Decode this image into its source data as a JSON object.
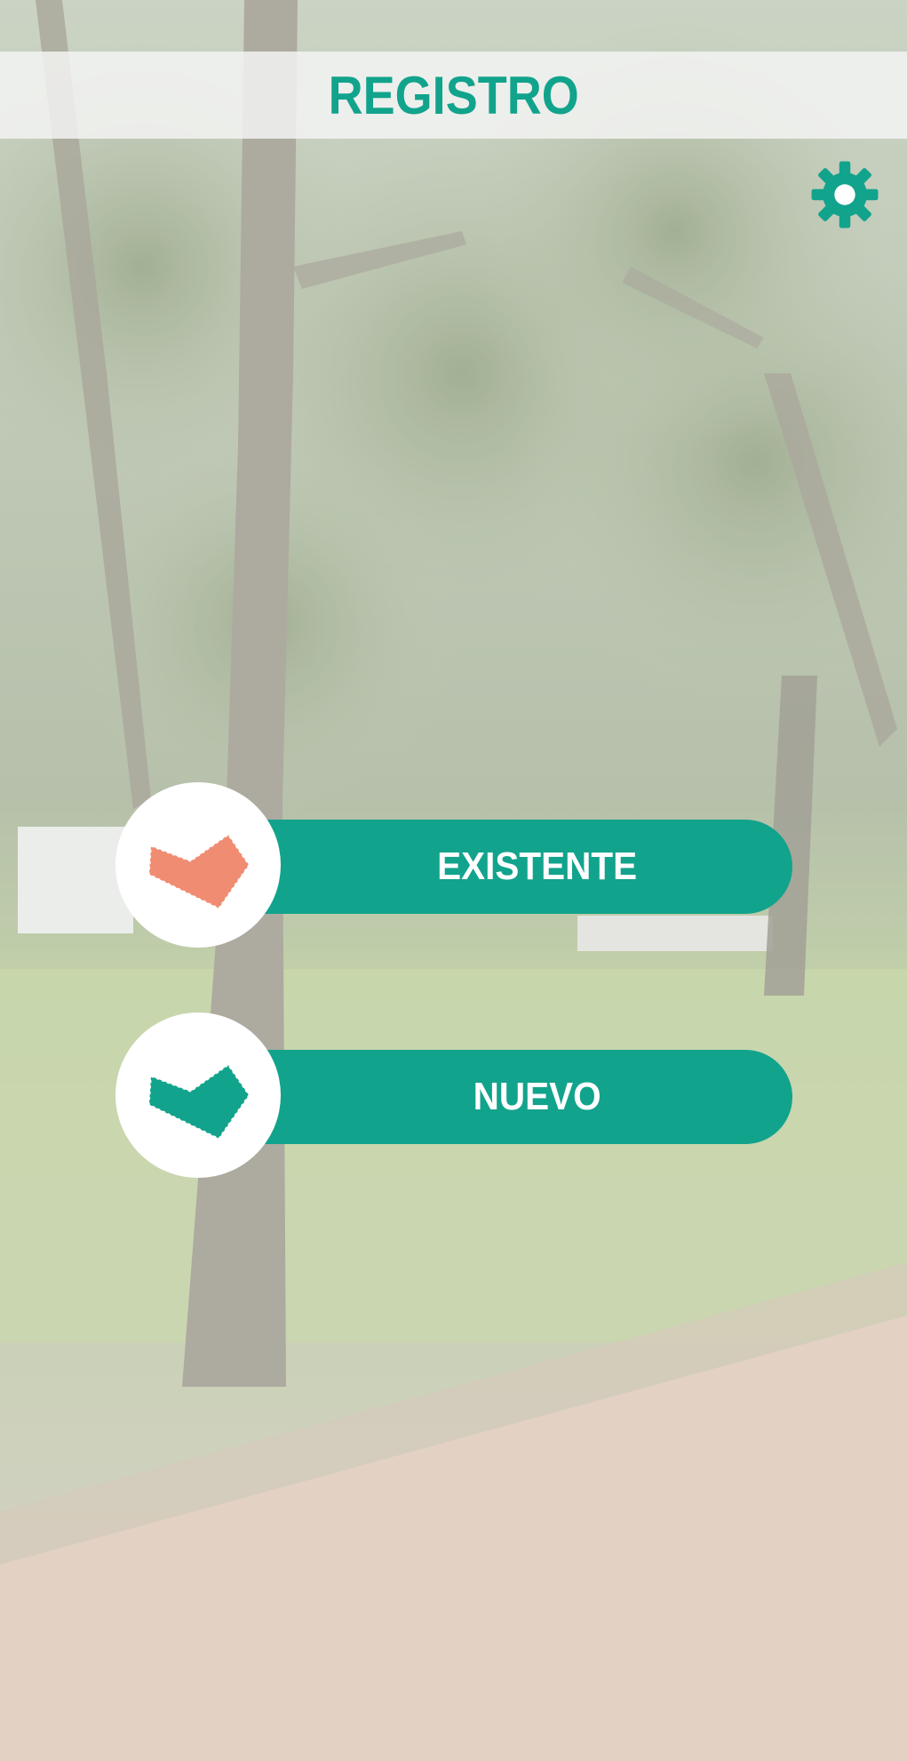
{
  "header": {
    "title": "REGISTRO"
  },
  "settings": {
    "icon": "gear-icon",
    "color": "#12a38c"
  },
  "options": [
    {
      "label": "EXISTENTE",
      "icon": "polygon-shape-icon",
      "icon_color": "#f08c72"
    },
    {
      "label": "NUEVO",
      "icon": "polygon-shape-icon",
      "icon_color": "#12a38c"
    }
  ],
  "colors": {
    "accent": "#12a38c",
    "bar_text": "#ffffff",
    "header_bg": "#f5f5f5"
  }
}
